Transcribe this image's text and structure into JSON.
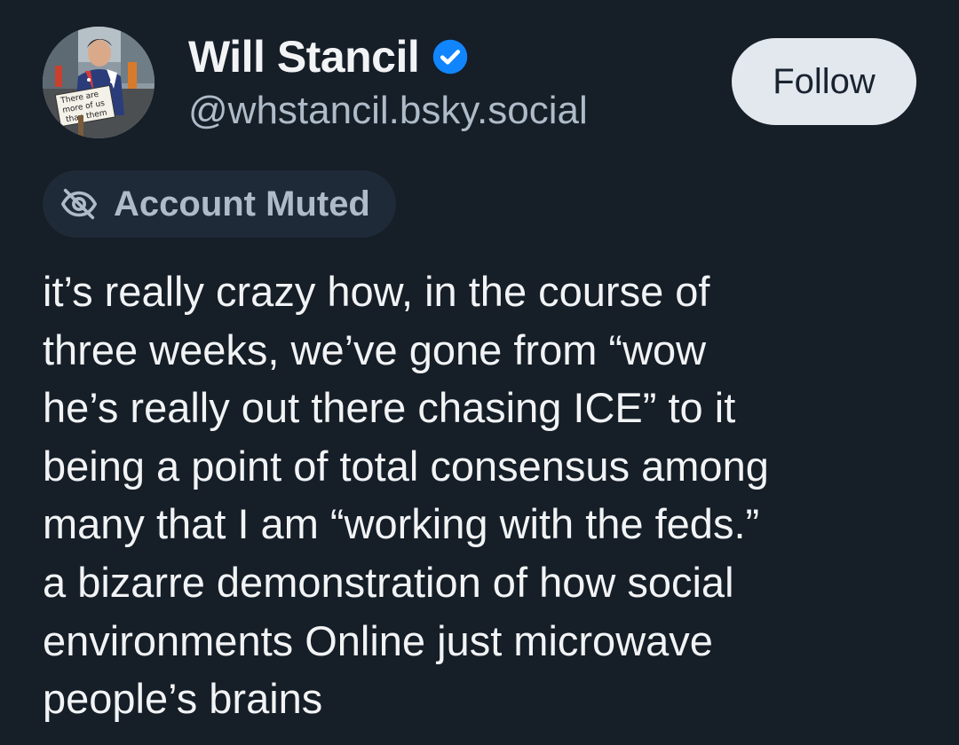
{
  "author": {
    "display_name": "Will Stancil",
    "handle": "@whstancil.bsky.social",
    "verified": true,
    "avatar_icon": "avatar-photo-with-protest-sign",
    "avatar_sign_text": "There are more of us than them"
  },
  "follow_button": {
    "label": "Follow"
  },
  "muted_badge": {
    "label": "Account Muted",
    "icon": "eye-slash-icon"
  },
  "post": {
    "text": "it’s really crazy how, in the course of\nthree weeks, we’ve gone from “wow\nhe’s really out there chasing ICE” to it\nbeing a point of total consensus among\nmany that I am “working with the feds.”\na bizarre demonstration of how social\nenvironments Online just microwave\npeople’s brains"
  },
  "colors": {
    "background": "#161e27",
    "text_primary": "#f1f3f5",
    "text_secondary": "#aebbc9",
    "verified_blue": "#1185fe",
    "button_bg": "#e3e8ef",
    "pill_bg": "#1e2a37"
  }
}
